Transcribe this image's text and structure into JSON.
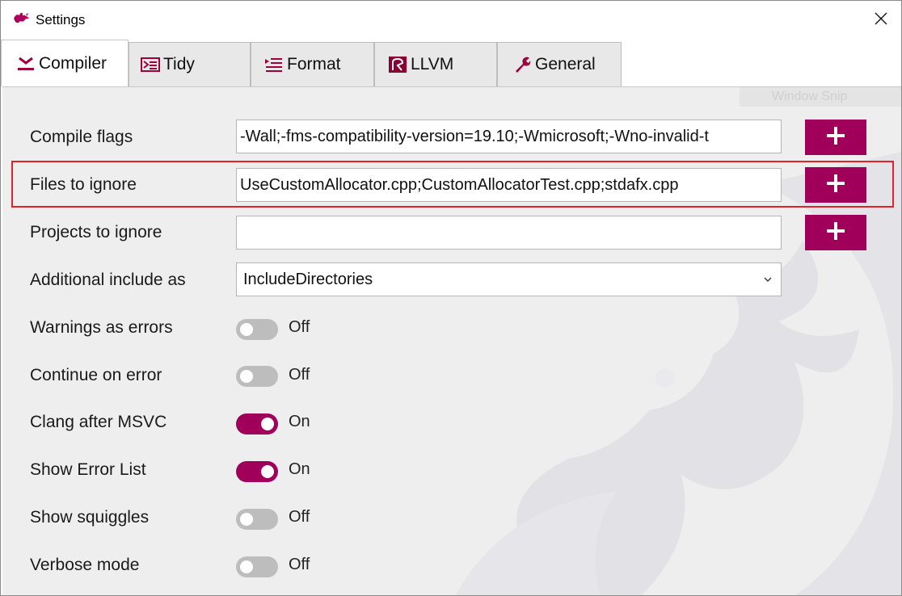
{
  "window": {
    "title": "Settings",
    "close_icon": "close-icon",
    "app_icon": "clang-dragon-icon"
  },
  "tabs": [
    {
      "label": "Compiler",
      "icon": "compiler-icon",
      "active": true
    },
    {
      "label": "Tidy",
      "icon": "tidy-icon",
      "active": false
    },
    {
      "label": "Format",
      "icon": "format-icon",
      "active": false
    },
    {
      "label": "LLVM",
      "icon": "llvm-icon",
      "active": false
    },
    {
      "label": "General",
      "icon": "wrench-icon",
      "active": false
    }
  ],
  "ghost_text": "Window Snip",
  "compiler": {
    "compile_flags": {
      "label": "Compile flags",
      "value": "-Wall;-fms-compatibility-version=19.10;-Wmicrosoft;-Wno-invalid-t"
    },
    "files_to_ignore": {
      "label": "Files to ignore",
      "value": "UseCustomAllocator.cpp;CustomAllocatorTest.cpp;stdafx.cpp"
    },
    "projects_to_ignore": {
      "label": "Projects to ignore",
      "value": ""
    },
    "additional_include": {
      "label": "Additional include as",
      "value": "IncludeDirectories"
    },
    "toggles": [
      {
        "label": "Warnings as errors",
        "state": "Off"
      },
      {
        "label": "Continue on error",
        "state": "Off"
      },
      {
        "label": "Clang after MSVC",
        "state": "On"
      },
      {
        "label": "Show Error List",
        "state": "On"
      },
      {
        "label": "Show squiggles",
        "state": "Off"
      },
      {
        "label": "Verbose mode",
        "state": "Off"
      }
    ]
  },
  "colors": {
    "accent": "#a0005a",
    "highlight": "#e0232b",
    "toggle_off": "#bdbdbd"
  }
}
